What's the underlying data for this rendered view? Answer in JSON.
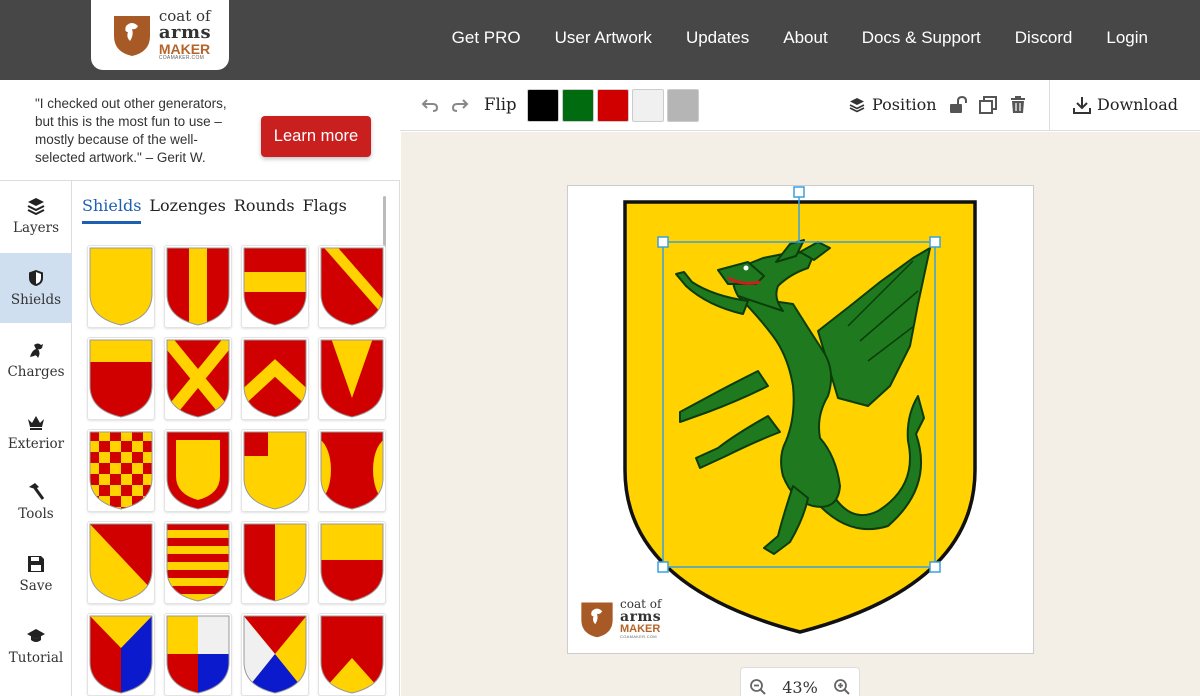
{
  "header": {
    "logo": {
      "line1": "coat of",
      "line2": "arms",
      "line3": "MAKER",
      "line4": "COAMAKER.COM"
    },
    "nav": [
      "Get PRO",
      "User Artwork",
      "Updates",
      "About",
      "Docs & Support",
      "Discord",
      "Login"
    ]
  },
  "promo": {
    "quote": "\"I checked out other generators, but this is the most fun to use – mostly because of the well-selected artwork.\" – Gerit W.",
    "button": "Learn more"
  },
  "sidebar": {
    "items": [
      {
        "label": "Layers",
        "icon": "layers-icon"
      },
      {
        "label": "Shields",
        "icon": "shield-icon"
      },
      {
        "label": "Charges",
        "icon": "griffin-icon"
      },
      {
        "label": "Exterior",
        "icon": "crown-icon"
      },
      {
        "label": "Tools",
        "icon": "hammer-icon"
      },
      {
        "label": "Save",
        "icon": "floppy-icon"
      },
      {
        "label": "Tutorial",
        "icon": "mortarboard-icon"
      }
    ],
    "active": "Shields"
  },
  "gallery": {
    "tabs": [
      "Shields",
      "Lozenges",
      "Rounds",
      "Flags"
    ],
    "active_tab": "Shields",
    "tiles": [
      "plain",
      "pale",
      "fess",
      "bend",
      "chief",
      "saltire",
      "chevron",
      "pile",
      "checky",
      "bordure",
      "canton",
      "flaunches",
      "per-bend",
      "barry",
      "per-pale",
      "per-fess",
      "tierced-pairle-reversed",
      "quarterly",
      "per-saltire",
      "chevronny-base"
    ]
  },
  "toolbar": {
    "undo_icon": "undo-icon",
    "redo_icon": "redo-icon",
    "flip": "Flip",
    "swatches": [
      "#000000",
      "#006b0f",
      "#d10000",
      "#f0f0f0",
      "#b5b5b5"
    ],
    "position": "Position",
    "download": "Download"
  },
  "canvas": {
    "zoom": "43%",
    "field_color": "#ffd200",
    "charge_color": "#1f7a1f",
    "charge": "Dragon rampant"
  },
  "colors": {
    "header_bg": "#474747",
    "accent_red": "#c91f1f",
    "active_blue": "#1d5fb0",
    "canvas_bg": "#f4efe6"
  }
}
